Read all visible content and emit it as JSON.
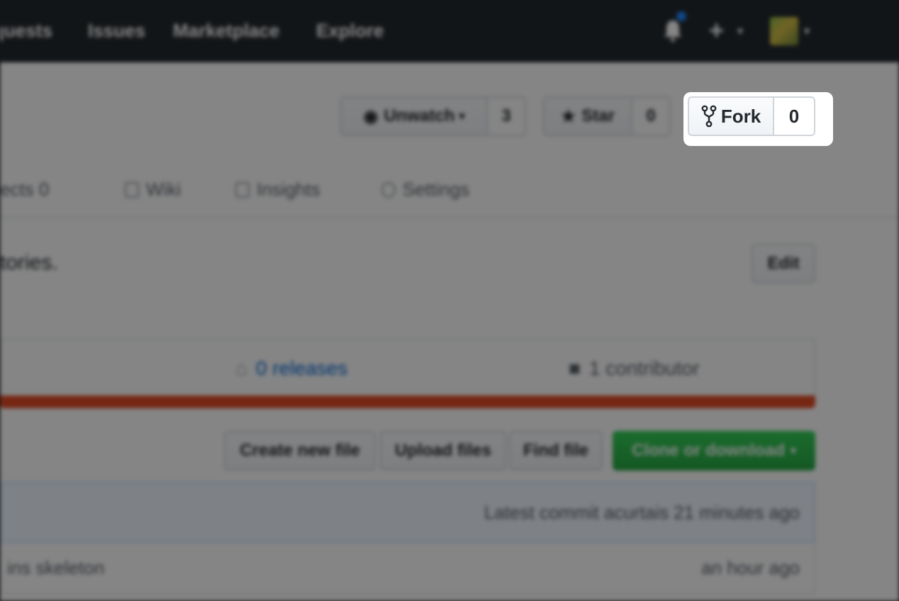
{
  "nav": {
    "links": [
      "quests",
      "Issues",
      "Marketplace",
      "Explore"
    ]
  },
  "repo_actions": {
    "unwatch_label": "Unwatch",
    "unwatch_count": "3",
    "star_label": "Star",
    "star_count": "0",
    "fork_label": "Fork",
    "fork_count": "0"
  },
  "tabs": [
    "ects 0",
    "Wiki",
    "Insights",
    "Settings"
  ],
  "description": {
    "text": "tories.",
    "edit_label": "Edit"
  },
  "summary": {
    "releases": "0 releases",
    "contributors": "1 contributor"
  },
  "file_actions": {
    "create": "Create new file",
    "upload": "Upload files",
    "find": "Find file",
    "clone": "Clone or download"
  },
  "commit": {
    "latest": "Latest commit acurtais 21 minutes ago"
  },
  "file_row": {
    "message": "ins skeleton",
    "age": "an hour ago"
  },
  "colors": {
    "nav_bg": "#24292e",
    "language_bar": "#e34c26",
    "clone_button": "#28a745"
  }
}
